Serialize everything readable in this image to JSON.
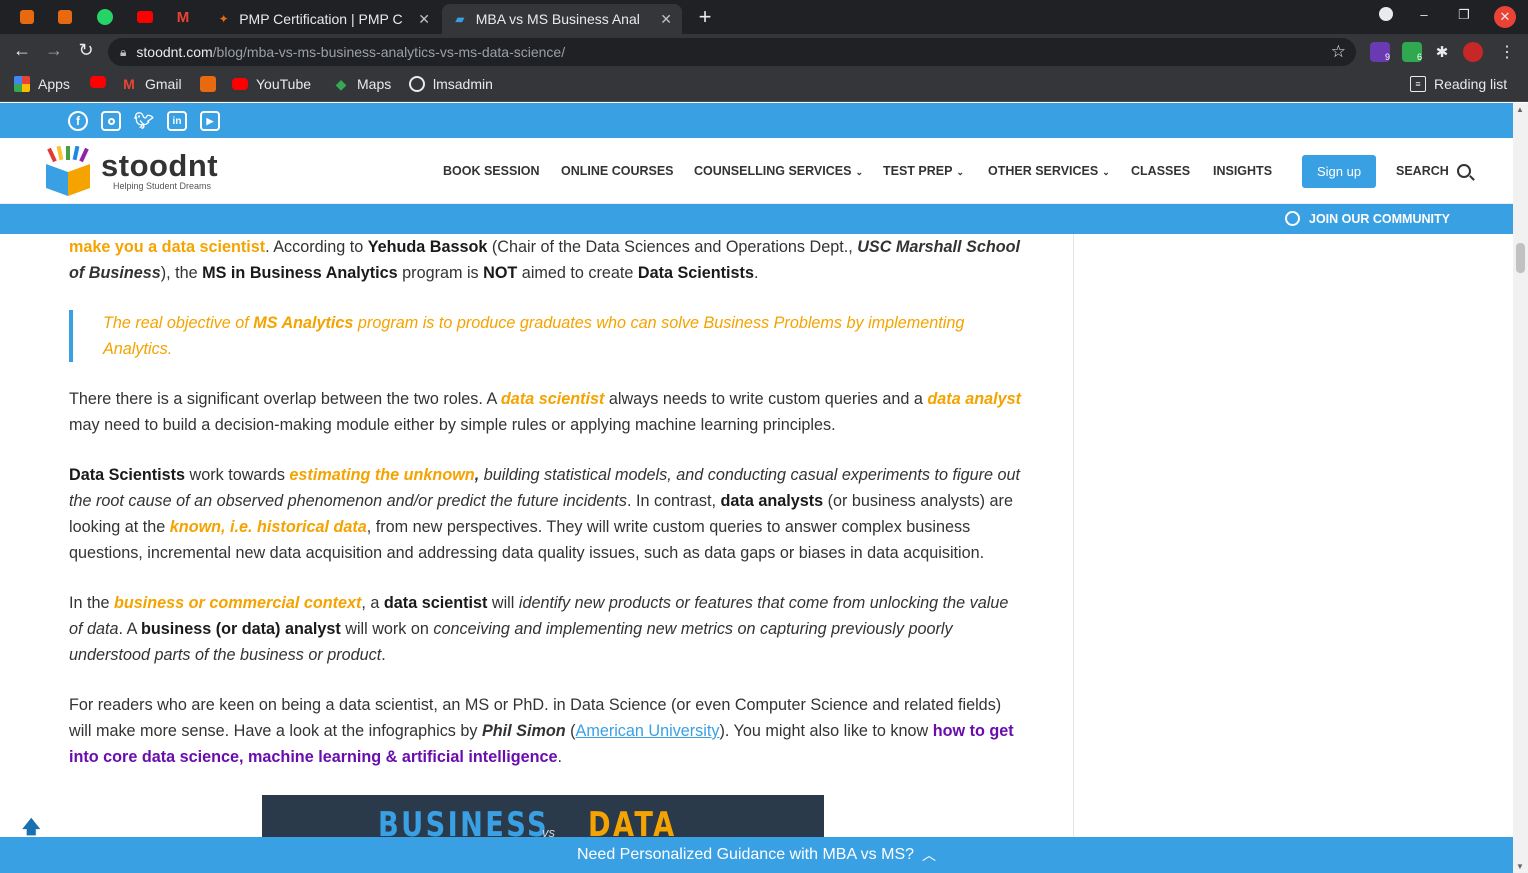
{
  "browser": {
    "tabs": [
      {
        "title": "PMP Certification | PMP C",
        "active": false
      },
      {
        "title": "MBA vs MS Business Anal",
        "active": true
      }
    ],
    "url_host": "stoodnt.com",
    "url_path": "/blog/mba-vs-ms-business-analytics-vs-ms-data-science/",
    "extension_badges": [
      "9",
      "6"
    ],
    "bookmarks": [
      "Apps",
      "Gmail",
      "YouTube",
      "Maps",
      "lmsadmin"
    ],
    "reading_list": "Reading list"
  },
  "site": {
    "logo_name": "stoodnt",
    "logo_tagline": "Helping Student Dreams",
    "social_icons": [
      "facebook-icon",
      "instagram-icon",
      "twitter-icon",
      "linkedin-icon",
      "youtube-icon"
    ],
    "menu": {
      "book_session": "BOOK SESSION",
      "online_courses": "ONLINE COURSES",
      "counselling": "COUNSELLING SERVICES",
      "test_prep": "TEST PREP",
      "other_services": "OTHER SERVICES",
      "classes": "CLASSES",
      "insights": "INSIGHTS"
    },
    "signup": "Sign up",
    "search": "SEARCH",
    "community": "JOIN OUR COMMUNITY",
    "accent": "#3aa0e4",
    "highlight": "#f4a300"
  },
  "article": {
    "p1": {
      "a": "make you a data scientist",
      "b": ". According to ",
      "c": "Yehuda Bassok",
      "d": " (Chair of the Data Sciences and Operations Dept., ",
      "e": "USC Marshall School of Business",
      "f": "), the ",
      "g": "MS in Business Analytics",
      "h": " program is ",
      "i": "NOT",
      "j": " aimed to create ",
      "k": "Data Scientists",
      "l": "."
    },
    "quote": {
      "a": "The real objective of ",
      "b": "MS Analytics",
      "c": " program is to produce graduates who can solve Business Problems by implementing Analytics."
    },
    "p2": {
      "a": "There there is a significant overlap between the two roles. A ",
      "b": "data scientist",
      "c": " always needs to write custom queries and a ",
      "d": "data analyst",
      "e": " may need to build a decision-making module either by simple rules or applying machine learning principles."
    },
    "p3": {
      "a": "Data Scientists",
      "b": " work towards ",
      "c": "estimating the unknown",
      "d": ", ",
      "e": "building statistical models, and conducting casual experiments to figure out the root cause of an observed phenomenon and/or predict the future incidents",
      "f": ". In contrast, ",
      "g": "data analysts",
      "h": " (or business analysts) are looking at the ",
      "i": "known, i.e. historical data",
      "j": ", from new perspectives. They will write custom queries to answer complex business questions, incremental new data acquisition and addressing data quality issues, such as data gaps or biases in data acquisition."
    },
    "p4": {
      "a": "In the ",
      "b": "business or commercial context",
      "c": ", a ",
      "d": "data scientist",
      "e": " will ",
      "f": "identify new products or features that come from unlocking the value of data",
      "g": ". A ",
      "h": "business (or data) analyst",
      "i": " will work on ",
      "j": "conceiving and implementing new metrics on capturing previously poorly understood parts of the business or product",
      "k": "."
    },
    "p5": {
      "a": "For readers who are keen on being a data scientist, an MS or PhD. in Data Science (or even Computer Science and related fields) will make more sense. Have a look at the infographics by ",
      "b": "Phil Simon",
      "c": " (",
      "d": "American University",
      "e": "). You might also like to know ",
      "f": "how to get into core data science, machine learning & artificial intelligence",
      "g": "."
    },
    "infographic": {
      "left": "BUSINESS",
      "vs": "vs",
      "right": "DATA"
    }
  },
  "bottom_bar": "Need Personalized Guidance with MBA vs MS?"
}
